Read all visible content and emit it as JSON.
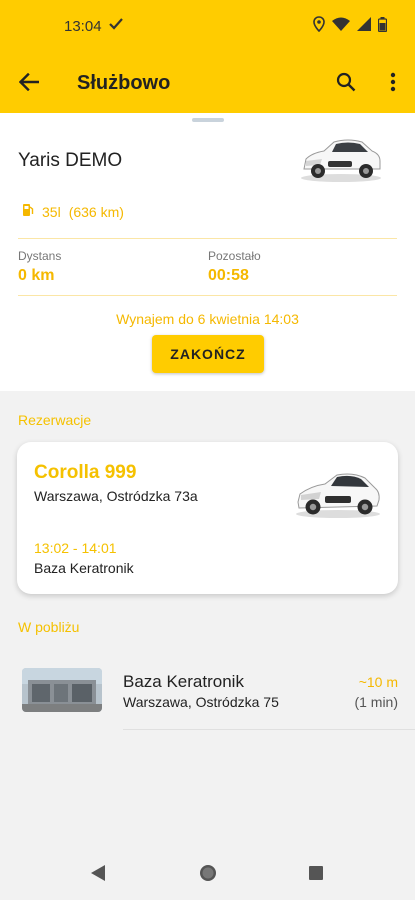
{
  "status_bar": {
    "time": "13:04",
    "icons": [
      "check-icon",
      "location-icon",
      "wifi-icon",
      "signal-icon",
      "battery-icon"
    ]
  },
  "app_bar": {
    "title": "Służbowo",
    "icons": [
      "back-arrow-icon",
      "search-icon",
      "more-vert-icon"
    ]
  },
  "active_rental": {
    "car_name": "Yaris DEMO",
    "fuel_icon": "fuel-pump-icon",
    "fuel": "35l",
    "range": "(636 km)",
    "distance_label": "Dystans",
    "distance_value": "0 km",
    "remaining_label": "Pozostało",
    "remaining_value": "00:58",
    "rental_until": "Wynajem do 6 kwietnia 14:03",
    "end_button": "ZAKOŃCZ"
  },
  "reservations": {
    "section_label": "Rezerwacje",
    "items": [
      {
        "title": "Corolla 999",
        "address": "Warszawa, Ostródzka 73a",
        "time": "13:02 - 14:01",
        "place": "Baza  Keratronik"
      }
    ]
  },
  "nearby": {
    "section_label": "W pobliżu",
    "items": [
      {
        "name": "Baza  Keratronik",
        "address": "Warszawa, Ostródzka 75",
        "distance": "~10 m",
        "time": "(1 min)"
      }
    ]
  },
  "colors": {
    "accent": "#ffcc00",
    "accent_text": "#f5b800",
    "background": "#f2f2f2"
  }
}
